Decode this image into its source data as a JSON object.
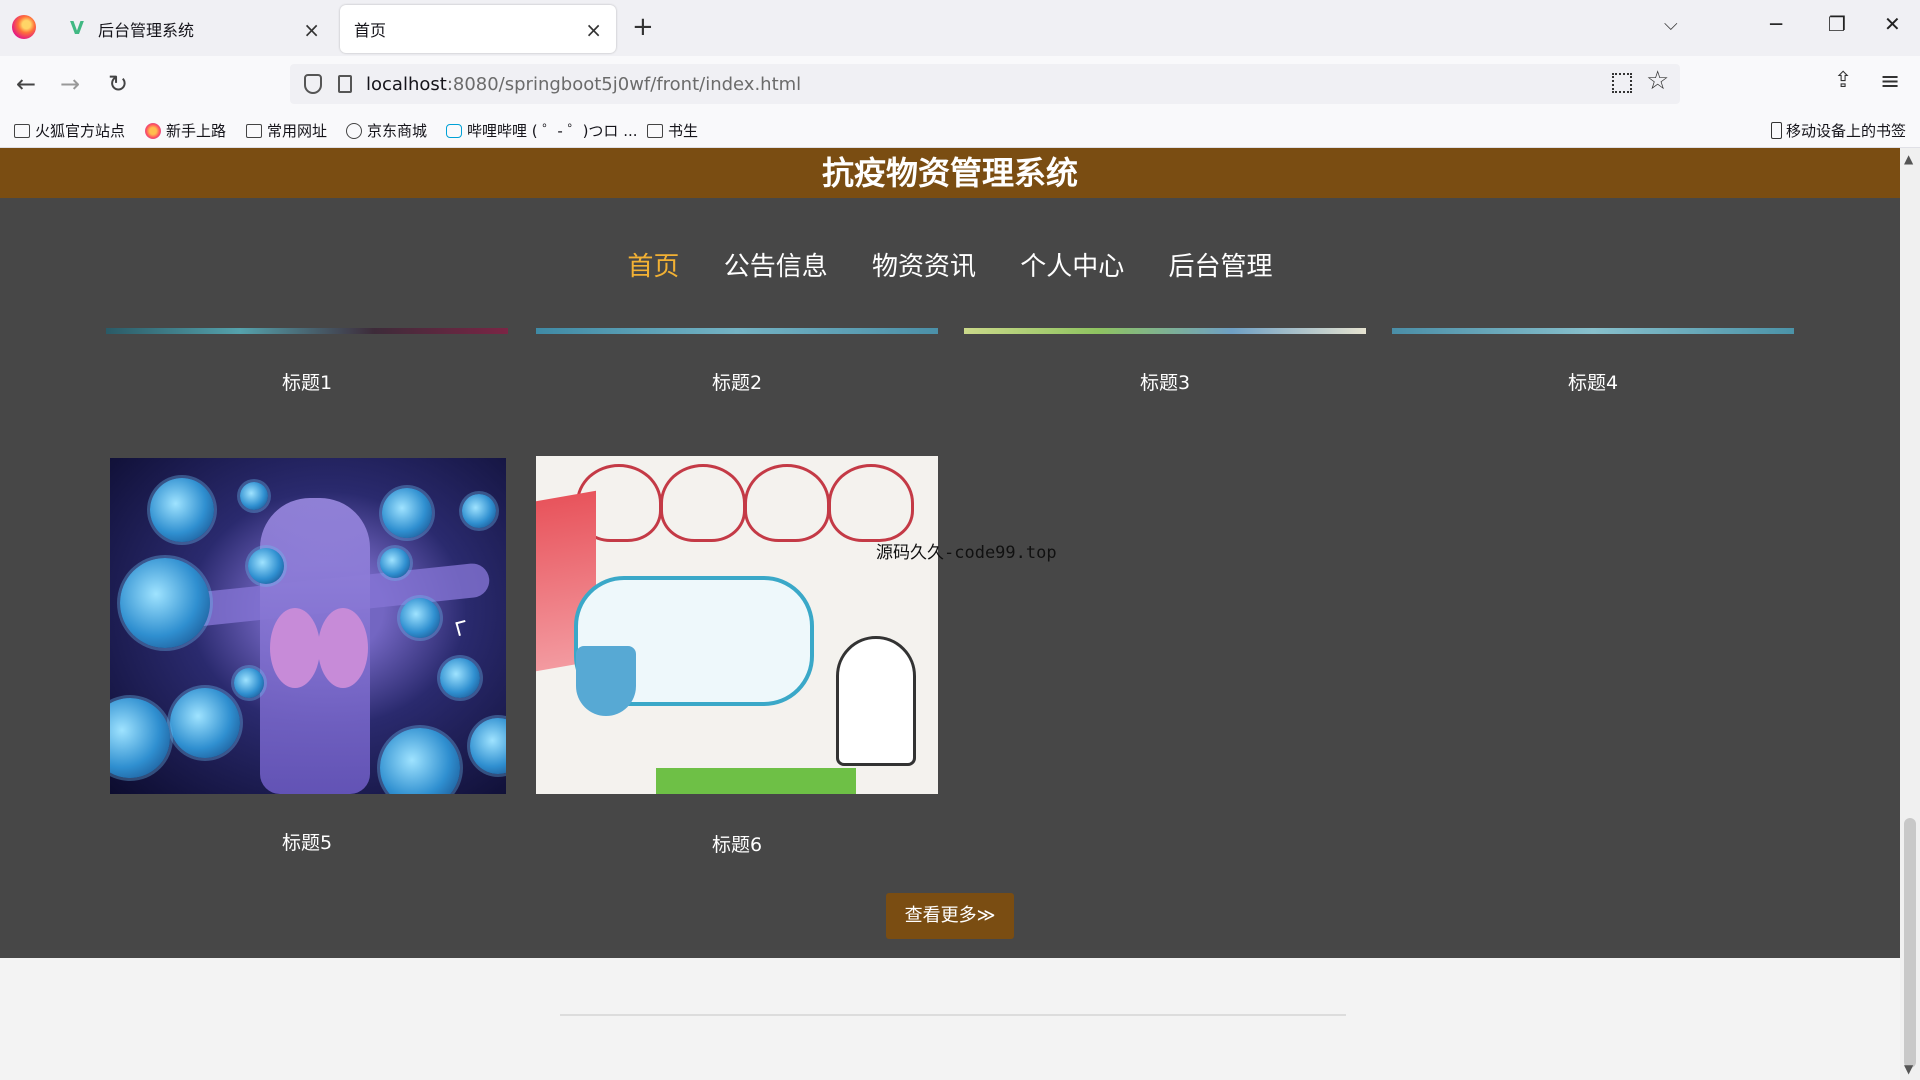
{
  "browser": {
    "tabs": [
      {
        "title": "后台管理系统"
      },
      {
        "title": "首页"
      }
    ],
    "url_host": "localhost",
    "url_rest": ":8080/springboot5j0wf/front/index.html",
    "bookmarks": [
      {
        "label": "火狐官方站点",
        "icon": "folder-icon"
      },
      {
        "label": "新手上路",
        "icon": "firefox-icon"
      },
      {
        "label": "常用网址",
        "icon": "folder-icon"
      },
      {
        "label": "京东商城",
        "icon": "globe-icon"
      },
      {
        "label": "哔哩哔哩 ( ゜- ゜)つロ ...",
        "icon": "bilibili-icon"
      },
      {
        "label": "书生",
        "icon": "folder-icon"
      }
    ],
    "mobile_bookmarks": "移动设备上的书签"
  },
  "site": {
    "title": "抗疫物资管理系统",
    "nav": [
      "首页",
      "公告信息",
      "物资资讯",
      "个人中心",
      "后台管理"
    ],
    "active_nav": "首页",
    "cards": [
      {
        "caption": "标题1"
      },
      {
        "caption": "标题2"
      },
      {
        "caption": "标题3"
      },
      {
        "caption": "标题4"
      },
      {
        "caption": "标题5"
      },
      {
        "caption": "标题6"
      }
    ],
    "more_button": "查看更多≫",
    "overlay_text": "源码久久-code99.top",
    "accent_color": "#7a4d12",
    "active_color": "#f2b134"
  }
}
